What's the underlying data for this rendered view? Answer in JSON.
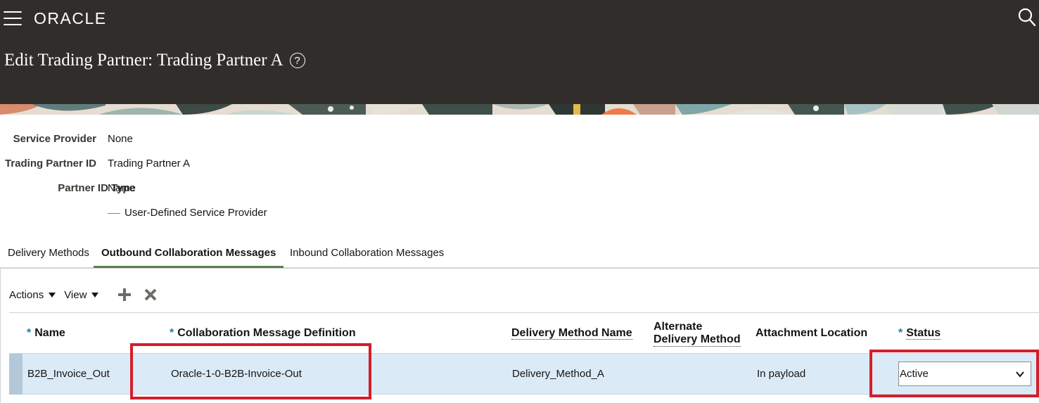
{
  "header": {
    "logo": "ORACLE",
    "page_title": "Edit Trading Partner: Trading Partner A",
    "help_glyph": "?"
  },
  "form": {
    "service_provider_label": "Service Provider",
    "service_provider_value": "None",
    "trading_partner_id_label": "Trading Partner ID",
    "trading_partner_id_value": "Trading Partner A",
    "partner_id_type_label": "Partner ID Type",
    "partner_id_type_value": "Name",
    "legend_text": "User-Defined Service Provider"
  },
  "tabs": [
    {
      "label": "Delivery Methods",
      "active": false
    },
    {
      "label": "Outbound Collaboration Messages",
      "active": true
    },
    {
      "label": "Inbound Collaboration Messages",
      "active": false
    }
  ],
  "toolbar": {
    "actions_label": "Actions",
    "view_label": "View",
    "add_icon": "plus-icon",
    "delete_icon": "x-icon"
  },
  "table": {
    "columns": [
      {
        "label": "Name",
        "required": true
      },
      {
        "label": "Collaboration Message Definition",
        "required": true
      },
      {
        "label": "Delivery Method Name",
        "required": false
      },
      {
        "label_line1": "Alternate",
        "label_line2": "Delivery Method",
        "required": false
      },
      {
        "label": "Attachment Location",
        "required": false
      },
      {
        "label": "Status",
        "required": true
      }
    ],
    "rows": [
      {
        "name": "B2B_Invoice_Out",
        "collaboration_message_definition": "Oracle-1-0-B2B-Invoice-Out",
        "delivery_method_name": "Delivery_Method_A",
        "alternate_delivery_method": "",
        "attachment_location": "In payload",
        "status": "Active"
      }
    ]
  },
  "colors": {
    "header_bg": "#312d2a",
    "active_tab_underline": "#5b7f52",
    "selected_row_bg": "#dbeaf7",
    "required_asterisk": "#227cab",
    "highlight_box": "#d21f2a"
  }
}
